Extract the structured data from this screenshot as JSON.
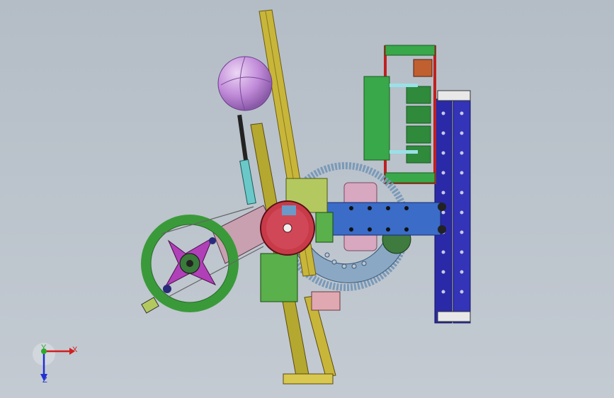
{
  "viewport": {
    "background": "#bcc4cc"
  },
  "triad": {
    "x_label": "X",
    "y_label": "Y",
    "z_label": "Z",
    "x_color": "#d21f1f",
    "y_color": "#2fa82f",
    "z_color": "#1f2fd2"
  },
  "model": {
    "parts": [
      {
        "name": "purple-ball",
        "color": "#c08ad8"
      },
      {
        "name": "yellow-rail",
        "color": "#c8b63a"
      },
      {
        "name": "green-pulley-wheel",
        "color": "#3a9a3a"
      },
      {
        "name": "magenta-spider-hub",
        "color": "#b040b8"
      },
      {
        "name": "red-drive-disc",
        "color": "#c83a48"
      },
      {
        "name": "blue-arm",
        "color": "#3a6cc8"
      },
      {
        "name": "grey-blue-sector-gear",
        "color": "#7a9ab8"
      },
      {
        "name": "dark-green-spur-gear",
        "color": "#3f7a3f"
      },
      {
        "name": "blue-vertical-column",
        "color": "#2a2aa8"
      },
      {
        "name": "green-control-box",
        "color": "#38a84a"
      },
      {
        "name": "red-frame",
        "color": "#c02020"
      },
      {
        "name": "pink-bracket",
        "color": "#d8a8c0"
      },
      {
        "name": "light-green-plates",
        "color": "#b4c860"
      }
    ]
  }
}
